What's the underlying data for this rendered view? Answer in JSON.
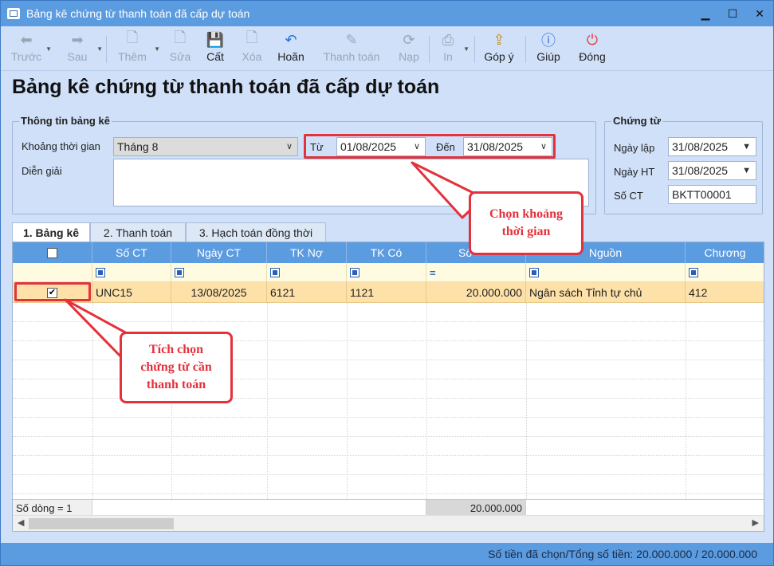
{
  "window": {
    "title": "Bảng kê chứng từ thanh toán đã cấp dự toán"
  },
  "toolbar": {
    "prev": "Trước",
    "next": "Sau",
    "add": "Thêm",
    "edit": "Sửa",
    "save": "Cất",
    "delete": "Xóa",
    "undo": "Hoãn",
    "pay": "Thanh toán",
    "load": "Nạp",
    "print": "In",
    "feedback": "Góp ý",
    "help": "Giúp",
    "close": "Đóng"
  },
  "page": {
    "title": "Bảng kê chứng từ thanh toán đã cấp dự toán"
  },
  "info": {
    "legend": "Thông tin bảng kê",
    "period_label": "Khoảng thời gian",
    "period_value": "Tháng 8",
    "from_label": "Từ",
    "from_value": "01/08/2025",
    "to_label": "Đến",
    "to_value": "31/08/2025",
    "desc_label": "Diễn giải"
  },
  "voucher": {
    "legend": "Chứng từ",
    "date_label": "Ngày lập",
    "date_value": "31/08/2025",
    "post_label": "Ngày HT",
    "post_value": "31/08/2025",
    "no_label": "Số CT",
    "no_value": "BKTT00001"
  },
  "tabs": [
    "1. Bảng kê",
    "2. Thanh toán",
    "3. Hạch toán đồng thời"
  ],
  "grid": {
    "columns": [
      "Số CT",
      "Ngày CT",
      "TK Nợ",
      "TK Có",
      "Số",
      "Nguồn",
      "Chương"
    ],
    "rows": [
      {
        "so_ct": "UNC15",
        "ngay_ct": "13/08/2025",
        "tk_no": "6121",
        "tk_co": "1121",
        "so_tien": "20.000.000",
        "nguon": "Ngân sách Tỉnh tự chủ",
        "chuong": "412"
      }
    ],
    "footer_count": "Số dòng = 1",
    "footer_total": "20.000.000"
  },
  "callouts": {
    "period": "Chọn khoảng thời gian",
    "check": "Tích chọn chứng từ cần thanh toán"
  },
  "status": "Số tiền đã chọn/Tổng số tiền: 20.000.000 / 20.000.000"
}
